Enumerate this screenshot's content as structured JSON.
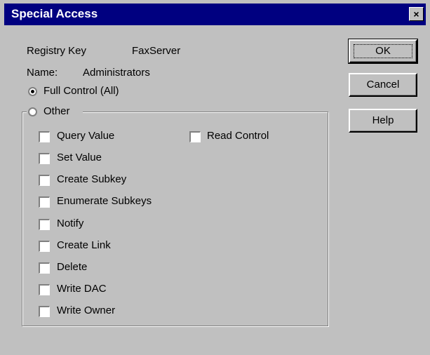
{
  "window": {
    "title": "Special Access",
    "close_glyph": "×"
  },
  "info": {
    "registry_key_label": "Registry Key",
    "registry_key_value": "FaxServer",
    "name_label": "Name:",
    "name_value": "Administrators"
  },
  "access": {
    "full_control_label": "Full Control (All)",
    "full_control_selected": true,
    "other_label": "Other"
  },
  "permissions_left": [
    {
      "label": "Query Value",
      "checked": false
    },
    {
      "label": "Set Value",
      "checked": false
    },
    {
      "label": "Create Subkey",
      "checked": false
    },
    {
      "label": "Enumerate Subkeys",
      "checked": false
    },
    {
      "label": "Notify",
      "checked": false
    },
    {
      "label": "Create Link",
      "checked": false
    },
    {
      "label": "Delete",
      "checked": false
    },
    {
      "label": "Write DAC",
      "checked": false
    },
    {
      "label": "Write Owner",
      "checked": false
    }
  ],
  "permissions_right": [
    {
      "label": "Read Control",
      "checked": false
    }
  ],
  "buttons": {
    "ok": "OK",
    "cancel": "Cancel",
    "help": "Help"
  }
}
